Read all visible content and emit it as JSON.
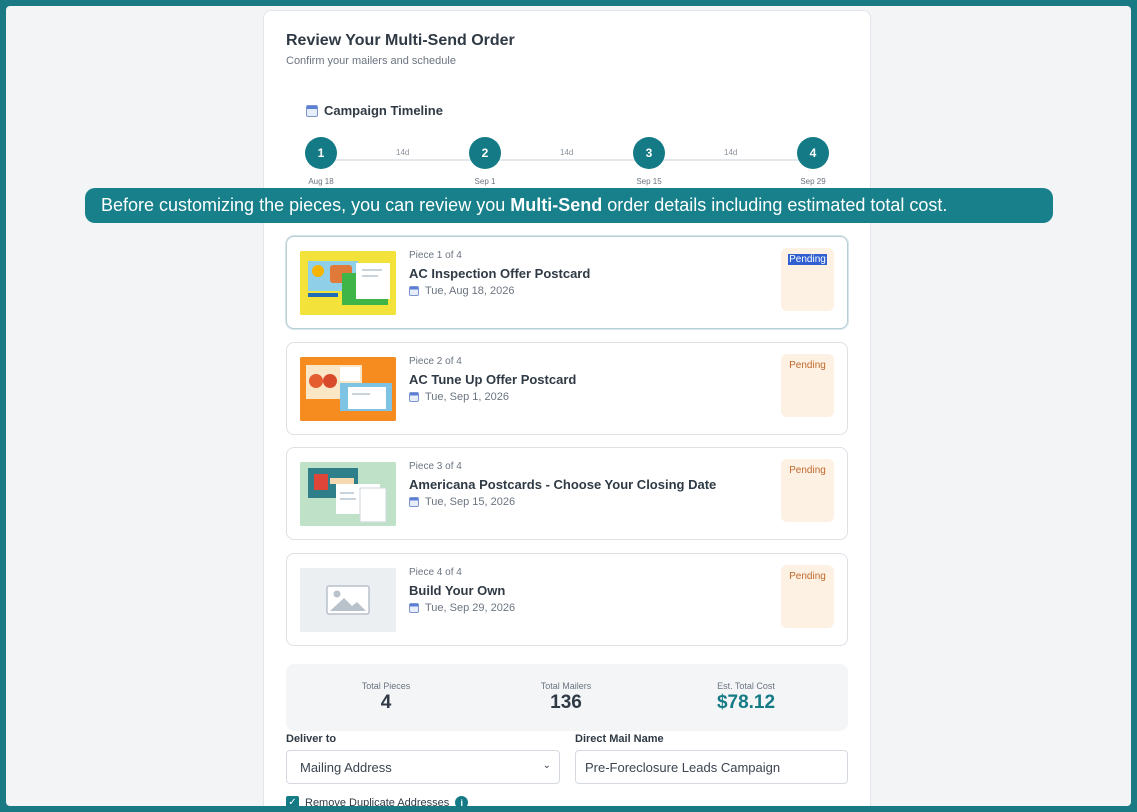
{
  "page": {
    "title": "Review Your Multi-Send Order",
    "subtitle": "Confirm your mailers and schedule"
  },
  "timeline": {
    "title": "Campaign Timeline",
    "steps": [
      {
        "num": "1",
        "date": "Aug 18"
      },
      {
        "num": "2",
        "date": "Sep 1"
      },
      {
        "num": "3",
        "date": "Sep 15"
      },
      {
        "num": "4",
        "date": "Sep 29"
      }
    ],
    "gaps": [
      "14d",
      "14d",
      "14d"
    ]
  },
  "tooltip": {
    "before": "Before customizing the pieces, you can review you ",
    "bold": "Multi-Send",
    "after": " order details including estimated total cost."
  },
  "pieces": [
    {
      "index": "Piece 1 of 4",
      "name": "AC Inspection Offer Postcard",
      "date": "Tue, Aug 18, 2026",
      "status": "Pending"
    },
    {
      "index": "Piece 2 of 4",
      "name": "AC Tune Up Offer Postcard",
      "date": "Tue, Sep 1, 2026",
      "status": "Pending"
    },
    {
      "index": "Piece 3 of 4",
      "name": "Americana Postcards - Choose Your Closing Date",
      "date": "Tue, Sep 15, 2026",
      "status": "Pending"
    },
    {
      "index": "Piece 4 of 4",
      "name": "Build Your Own",
      "date": "Tue, Sep 29, 2026",
      "status": "Pending"
    }
  ],
  "summary": {
    "total_pieces_label": "Total Pieces",
    "total_pieces": "4",
    "total_mailers_label": "Total Mailers",
    "total_mailers": "136",
    "cost_label": "Est. Total Cost",
    "cost": "$78.12"
  },
  "form": {
    "deliver_label": "Deliver to",
    "deliver_value": "Mailing Address",
    "name_label": "Direct Mail Name",
    "name_value": "Pre-Foreclosure Leads Campaign",
    "dedupe_label": "Remove Duplicate Addresses"
  },
  "colors": {
    "accent": "#147a85",
    "frame": "#1a7a84",
    "pending_bg": "#fdf1e3",
    "pending_text": "#c0682b"
  }
}
